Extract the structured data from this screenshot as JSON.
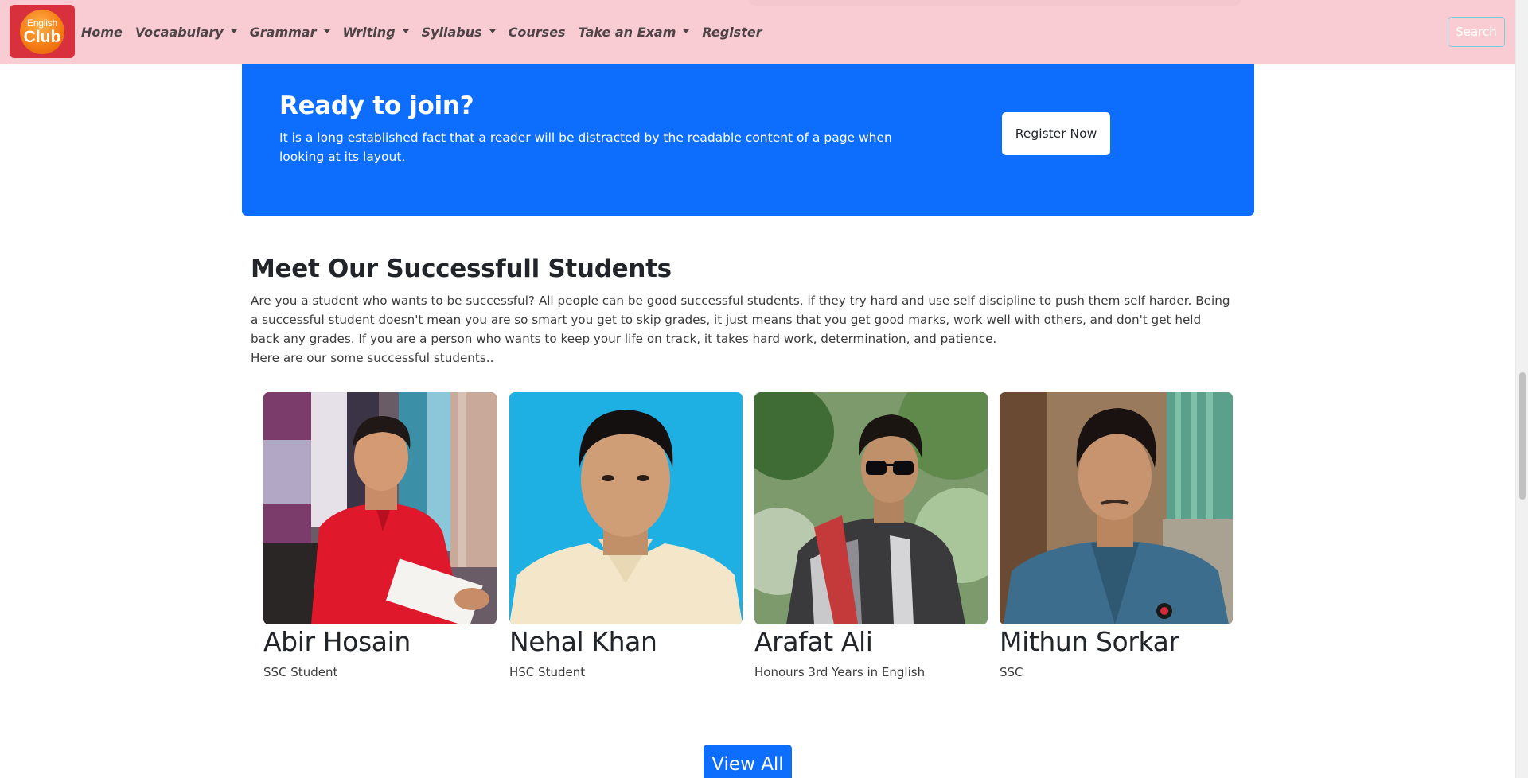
{
  "navbar": {
    "logo": {
      "line1": "English",
      "line2": "Club"
    },
    "links": [
      {
        "label": "Home",
        "has_dropdown": false
      },
      {
        "label": "Vocaabulary",
        "has_dropdown": true
      },
      {
        "label": "Grammar",
        "has_dropdown": true
      },
      {
        "label": "Writing",
        "has_dropdown": true
      },
      {
        "label": "Syllabus",
        "has_dropdown": true
      },
      {
        "label": "Courses",
        "has_dropdown": false
      },
      {
        "label": "Take an Exam",
        "has_dropdown": true
      },
      {
        "label": "Register",
        "has_dropdown": false
      }
    ],
    "search_label": "Search"
  },
  "cta": {
    "title": "Ready to join?",
    "text": "It is a long established fact that a reader will be distracted by the readable content of a page when looking at its layout.",
    "button_label": "Register Now"
  },
  "students_section": {
    "title": "Meet Our Successfull Students",
    "description": "Are you a student who wants to be successful? All people can be good successful students, if they try hard and use self discipline to push them self harder. Being a successful student doesn't mean you are so smart you get to skip grades, it just means that you get good marks, work well with others, and don't get held back any grades. If you are a person who wants to keep your life on track, it takes hard work, determination, and patience.",
    "subtext": "Here are our some successful students..",
    "students": [
      {
        "name": "Abir Hosain",
        "role": "SSC Student"
      },
      {
        "name": "Nehal Khan",
        "role": "HSC Student"
      },
      {
        "name": "Arafat Ali",
        "role": "Honours 3rd Years in English"
      },
      {
        "name": "Mithun Sorkar",
        "role": "SSC"
      }
    ],
    "view_all_label": "View All"
  },
  "colors": {
    "navbar_bg": "#f8ccd2",
    "primary": "#0d6efd",
    "logo_bg": "#d8303d",
    "logo_circle": "#f57d16"
  }
}
